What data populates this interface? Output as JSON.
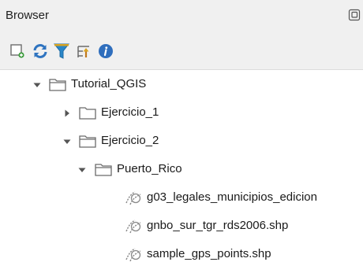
{
  "panel": {
    "title": "Browser",
    "float_icon": "float-dock-icon"
  },
  "toolbar": {
    "buttons": [
      {
        "name": "add-selected-layers-icon"
      },
      {
        "name": "refresh-icon"
      },
      {
        "name": "filter-icon"
      },
      {
        "name": "collapse-all-icon"
      },
      {
        "name": "info-icon"
      }
    ]
  },
  "tree": {
    "items": [
      {
        "label": "Tutorial_QGIS",
        "type": "folder",
        "expanded": true
      },
      {
        "label": "Ejercicio_1",
        "type": "folder",
        "expanded": false
      },
      {
        "label": "Ejercicio_2",
        "type": "folder",
        "expanded": true
      },
      {
        "label": "Puerto_Rico",
        "type": "folder",
        "expanded": true
      },
      {
        "label": "g03_legales_municipios_edicion",
        "type": "line-layer"
      },
      {
        "label": "gnbo_sur_tgr_rds2006.shp",
        "type": "line-layer"
      },
      {
        "label": "sample_gps_points.shp",
        "type": "line-layer"
      }
    ]
  },
  "colors": {
    "titlebar_bg": "#f0f0f0",
    "refresh": "#2f74c0",
    "filter": "#2a86c8",
    "info": "#2f6ebd",
    "folder_stroke": "#6b6b6b"
  }
}
